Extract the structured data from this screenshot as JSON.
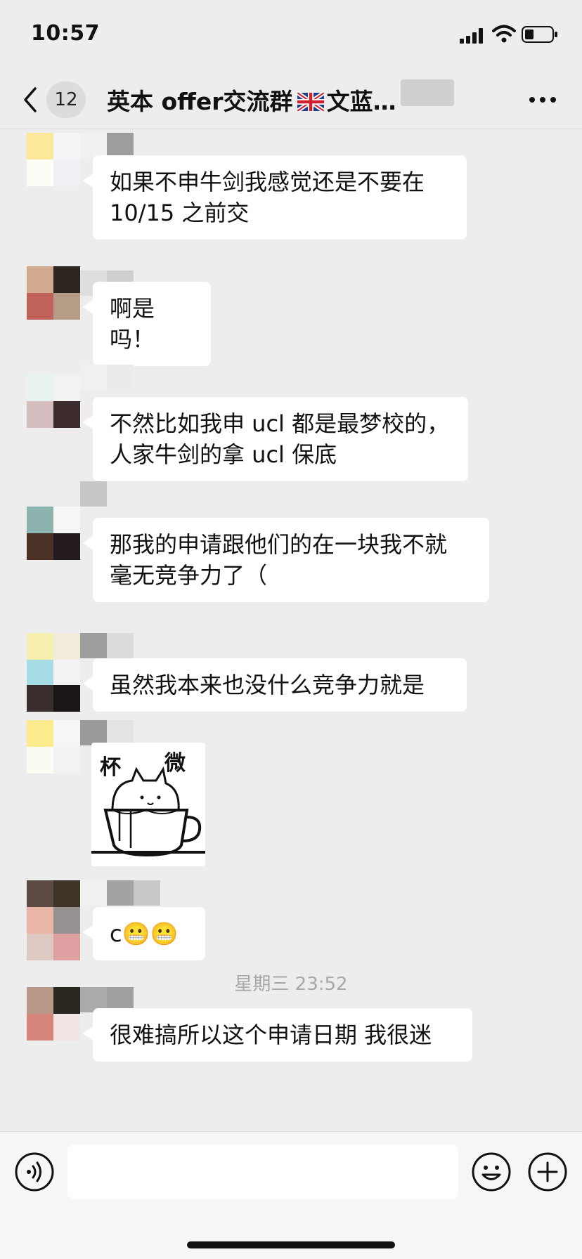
{
  "status_bar": {
    "time": "10:57"
  },
  "header": {
    "badge_count": "12",
    "title_before_flag": "英本 offer交流群",
    "title_after_flag": "文蓝…"
  },
  "messages": [
    {
      "type": "text",
      "text": "如果不申牛剑我感觉还是不要在\n10/15 之前交"
    },
    {
      "type": "text",
      "text": "啊是吗！"
    },
    {
      "type": "text",
      "text": "不然比如我申 ucl 都是最梦校的，\n人家牛剑的拿 ucl 保底"
    },
    {
      "type": "text",
      "text": "那我的申请跟他们的在一块我不就\n毫无竞争力了（"
    },
    {
      "type": "text",
      "text": "虽然我本来也没什么竞争力就是"
    },
    {
      "type": "sticker",
      "sticker_text_left": "杯",
      "sticker_text_right": "微",
      "sticker_icon": "cat-in-cup"
    },
    {
      "type": "text",
      "text": "c😬😬"
    },
    {
      "type": "text",
      "text": "很难搞所以这个申请日期 我很迷"
    }
  ],
  "time_separator": "星期三 23:52",
  "input": {
    "placeholder": ""
  },
  "icons": [
    "back-arrow-icon",
    "uk-flag-icon",
    "more-icon",
    "voice-icon",
    "emoji-icon",
    "plus-icon"
  ]
}
